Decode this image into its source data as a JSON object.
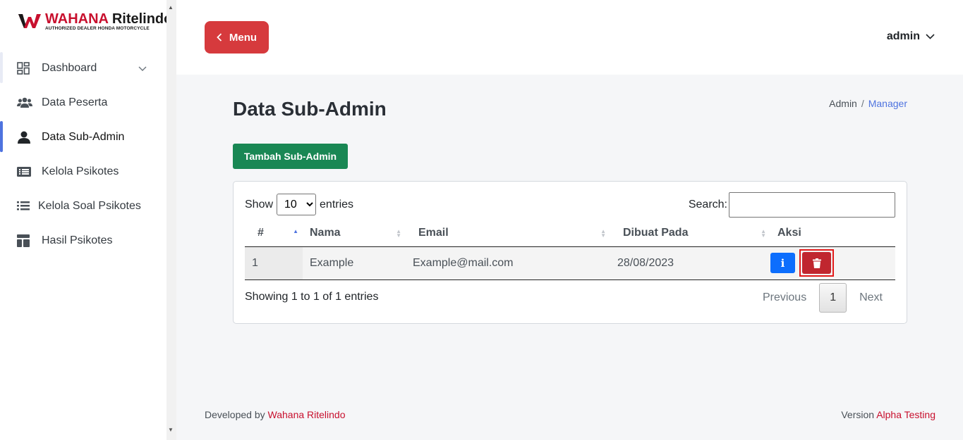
{
  "brand": {
    "name_part1": "WAHANA",
    "name_part2": "Ritelindo",
    "tagline": "AUTHORIZED DEALER HONDA MOTORCYCLE",
    "color": "#c8102e"
  },
  "sidebar": {
    "items": [
      {
        "label": "Dashboard",
        "icon": "dashboard-icon"
      },
      {
        "label": "Data Peserta",
        "icon": "users-icon"
      },
      {
        "label": "Data Sub-Admin",
        "icon": "user-icon",
        "active": true
      },
      {
        "label": "Kelola Psikotes",
        "icon": "list-alt-icon"
      },
      {
        "label": "Kelola Soal Psikotes",
        "icon": "list-icon"
      },
      {
        "label": "Hasil Psikotes",
        "icon": "layout-icon"
      }
    ]
  },
  "header": {
    "menu_label": "Menu",
    "user_label": "admin"
  },
  "main": {
    "title": "Data Sub-Admin",
    "breadcrumb": {
      "root": "Admin",
      "separator": "/",
      "current": "Manager"
    },
    "add_button_label": "Tambah Sub-Admin"
  },
  "table": {
    "length": {
      "before": "Show",
      "value": "10",
      "after": "entries"
    },
    "search_label": "Search:",
    "search_value": "",
    "columns": [
      "#",
      "Nama",
      "Email",
      "Dibuat Pada",
      "Aksi"
    ],
    "rows": [
      {
        "no": "1",
        "nama": "Example",
        "email": "Example@mail.com",
        "dibuat": "28/08/2023"
      }
    ],
    "info": "Showing 1 to 1 of 1 entries",
    "pagination": {
      "previous": "Previous",
      "current": "1",
      "next": "Next"
    },
    "info_button_label": "i"
  },
  "footer": {
    "developed_prefix": "Developed by",
    "developer": "Wahana Ritelindo",
    "version_prefix": "Version",
    "version": "Alpha Testing"
  },
  "colors": {
    "accent": "#4e73df",
    "danger": "#c0262f",
    "menu_button": "#d63a3d",
    "success": "#198754",
    "info": "#0d6efd"
  }
}
